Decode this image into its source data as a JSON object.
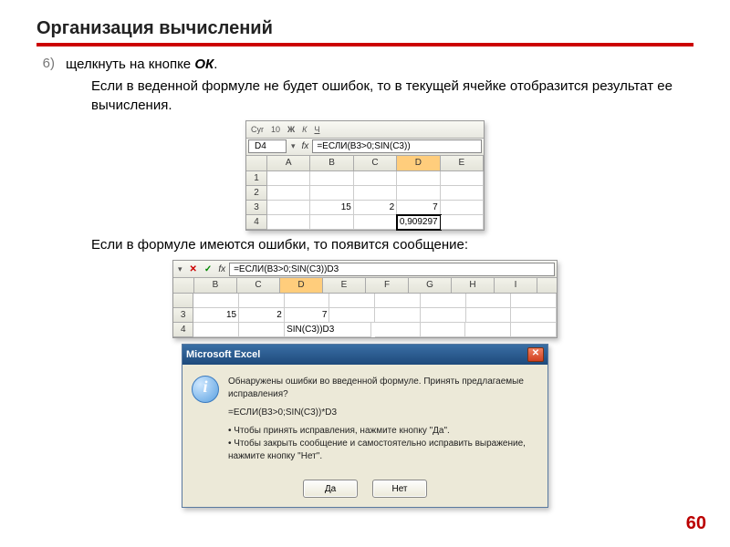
{
  "slide": {
    "title": "Организация вычислений",
    "list_num": "6)",
    "line1_a": "щелкнуть на кнопке ",
    "line1_b": "ОК",
    "line2": "Если в веденной формуле не будет ошибок, то в текущей ячейке отобразится результат ее вычисления.",
    "line3": "Если в формуле имеются ошибки, то появится сообщение:",
    "pagenum": "60"
  },
  "snip1": {
    "hint_row": {
      "a": "Cyr",
      "b": "10"
    },
    "namebox": "D4",
    "formula": "=ЕСЛИ(B3>0;SIN(C3))",
    "cols": [
      "A",
      "B",
      "C",
      "D",
      "E"
    ],
    "rows": {
      "r1": "1",
      "r2": "2",
      "r3": "3",
      "b3": "15",
      "c3": "2",
      "d3": "7",
      "r4": "4",
      "d4": "0,909297"
    }
  },
  "snip2": {
    "formula": "=ЕСЛИ(B3>0;SIN(C3))D3",
    "cols": [
      "B",
      "C",
      "D",
      "E",
      "F",
      "G",
      "H",
      "I"
    ],
    "r3": "3",
    "b3": "15",
    "c3": "2",
    "d3": "7",
    "r4": "4",
    "d4": "SIN(C3))D3"
  },
  "dialog": {
    "title": "Microsoft Excel",
    "msg1": "Обнаружены ошибки во введенной формуле. Принять предлагаемые исправления?",
    "msg2": "=ЕСЛИ(B3>0;SIN(C3))*D3",
    "bullet1": "Чтобы принять исправления, нажмите кнопку \"Да\".",
    "bullet2": "Чтобы закрыть сообщение и самостоятельно исправить выражение, нажмите кнопку \"Нет\".",
    "btn_yes": "Да",
    "btn_no": "Нет"
  }
}
